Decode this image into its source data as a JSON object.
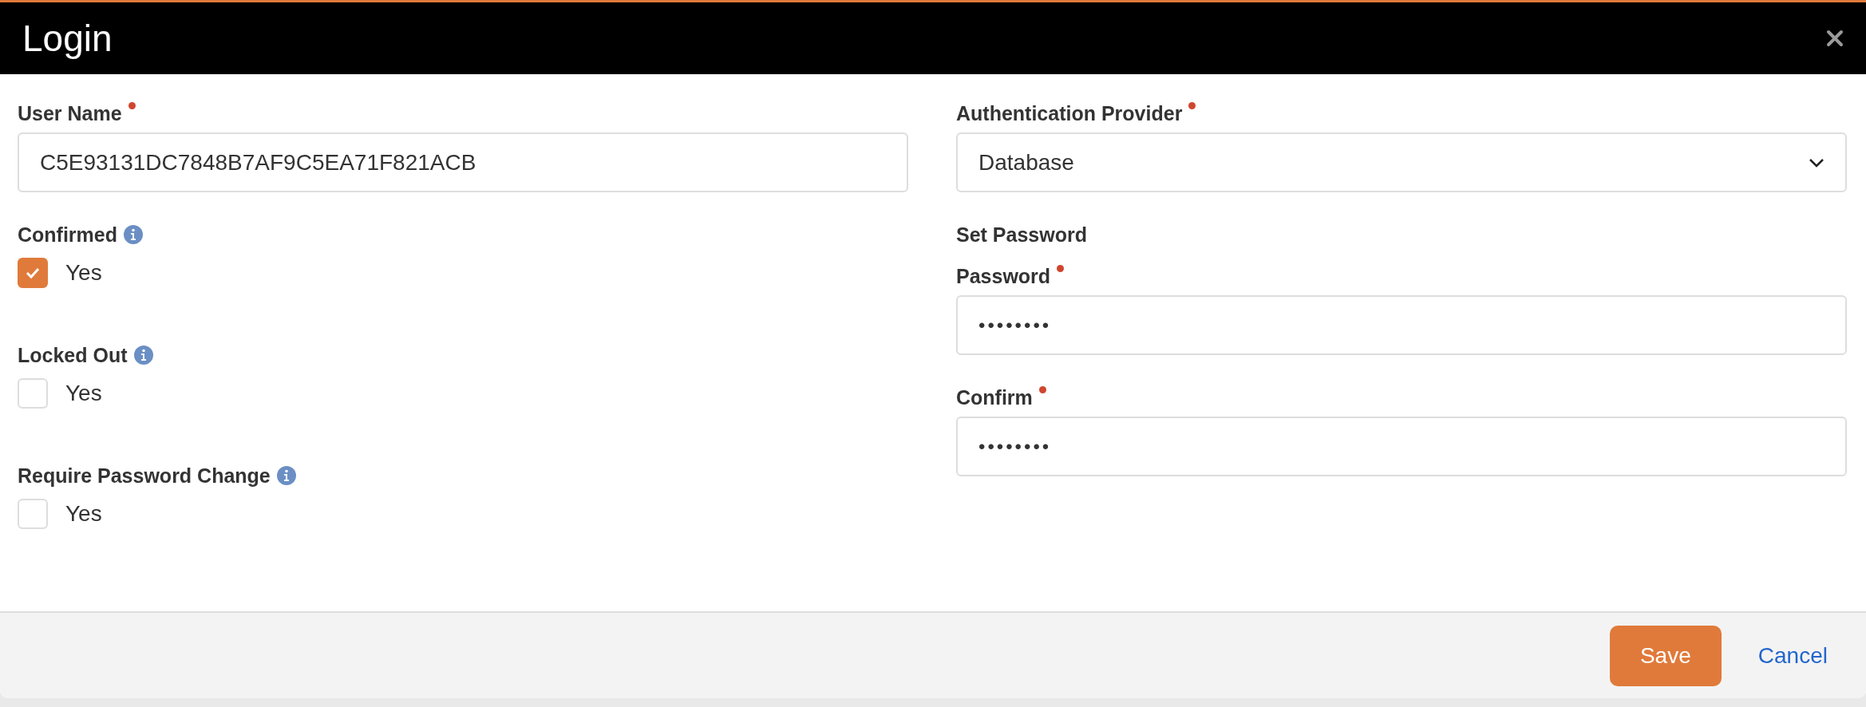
{
  "dialog": {
    "title": "Login"
  },
  "left_fields": [
    {
      "kind": "text",
      "label": "User Name",
      "required": true,
      "info": false,
      "value": "C5E93131DC7848B7AF9C5EA71F821ACB"
    },
    {
      "kind": "checkbox",
      "label": "Confirmed",
      "required": false,
      "info": true,
      "option": "Yes",
      "checked": true
    },
    {
      "kind": "checkbox",
      "label": "Locked Out",
      "required": false,
      "info": true,
      "option": "Yes",
      "checked": false
    },
    {
      "kind": "checkbox",
      "label": "Require Password Change",
      "required": false,
      "info": true,
      "option": "Yes",
      "checked": false
    }
  ],
  "right_fields": [
    {
      "kind": "select",
      "label": "Authentication Provider",
      "required": true,
      "info": false,
      "value": "Database"
    },
    {
      "kind": "heading",
      "label": "Set Password"
    },
    {
      "kind": "password",
      "label": "Password",
      "required": true,
      "info": false,
      "value": "••••••••"
    },
    {
      "kind": "password",
      "label": "Confirm",
      "required": true,
      "info": false,
      "value": "••••••••"
    }
  ],
  "buttons": [
    {
      "kind": "primary",
      "label": "Save"
    },
    {
      "kind": "link",
      "label": "Cancel"
    }
  ]
}
